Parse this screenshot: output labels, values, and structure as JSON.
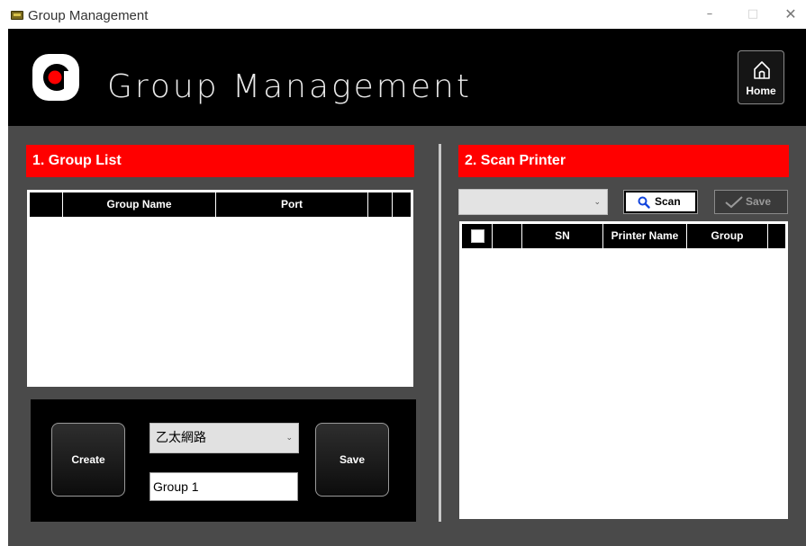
{
  "window": {
    "title": "Group Management",
    "minimize": "–",
    "maximize": "□",
    "close": "✕"
  },
  "header": {
    "brand": "Group Management",
    "home_label": "Home"
  },
  "group_list": {
    "title": "1. Group List",
    "columns": [
      "",
      "Group Name",
      "Port",
      "",
      ""
    ],
    "rows": []
  },
  "create_panel": {
    "create_label": "Create",
    "port_select_value": "乙太網路",
    "group_name_value": "Group 1",
    "save_label": "Save"
  },
  "scan_printer": {
    "title": "2. Scan Printer",
    "select_value": "",
    "scan_label": "Scan",
    "save_label": "Save",
    "columns": [
      "",
      "",
      "SN",
      "Printer Name",
      "Group",
      ""
    ],
    "rows": []
  },
  "colors": {
    "accent": "#ff0000",
    "banner": "#000000",
    "panel_bg": "#4a4a4a"
  }
}
